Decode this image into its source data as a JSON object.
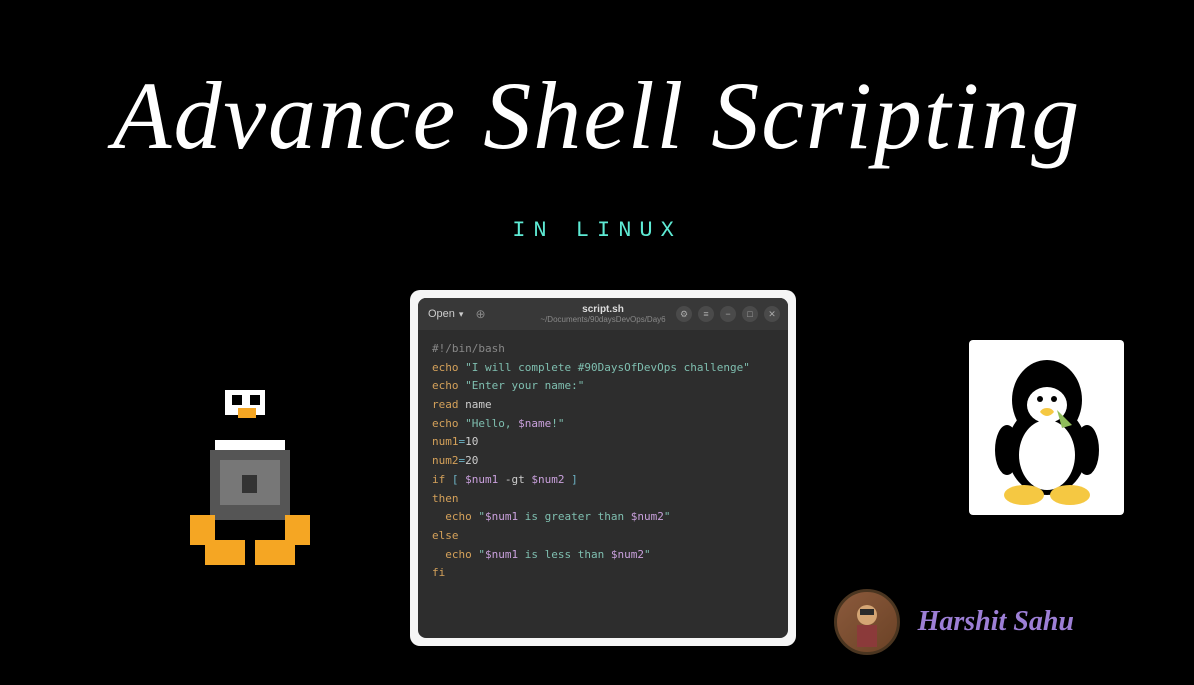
{
  "title": "Advance Shell Scripting",
  "subtitle": "IN LINUX",
  "editor": {
    "open_button": "Open",
    "filename": "script.sh",
    "filepath": "~/Documents/90daysDevOps/Day6",
    "code": {
      "shebang": "#!/bin/bash",
      "echo1_kw": "echo",
      "echo1_str": "\"I will complete #90DaysOfDevOps challenge\"",
      "echo2_kw": "echo",
      "echo2_str": "\"Enter your name:\"",
      "read_kw": "read",
      "read_var": "name",
      "echo3_kw": "echo",
      "echo3_str_a": "\"Hello, ",
      "echo3_var": "$name",
      "echo3_str_b": "!\"",
      "num1_var": "num1",
      "num1_eq": "=",
      "num1_val": "10",
      "num2_var": "num2",
      "num2_eq": "=",
      "num2_val": "20",
      "if_kw": "if",
      "if_br1": "[ ",
      "if_v1": "$num1",
      "if_op": " -gt ",
      "if_v2": "$num2",
      "if_br2": " ]",
      "then_kw": "then",
      "echo4_kw": "echo",
      "echo4_str_a": "\"",
      "echo4_v1": "$num1",
      "echo4_mid": " is greater than ",
      "echo4_v2": "$num2",
      "echo4_str_b": "\"",
      "else_kw": "else",
      "echo5_kw": "echo",
      "echo5_str_a": "\"",
      "echo5_v1": "$num1",
      "echo5_mid": " is less than ",
      "echo5_v2": "$num2",
      "echo5_str_b": "\"",
      "fi_kw": "fi"
    }
  },
  "author": {
    "name": "Harshit Sahu"
  }
}
